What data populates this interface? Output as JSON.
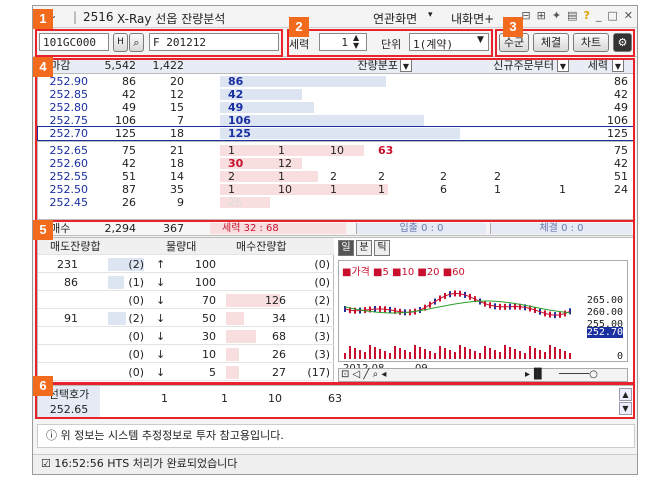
{
  "title": {
    "app": "N~",
    "screen_no": "2516",
    "name": "X-Ray 선옵 잔량분석",
    "menu1": "연관화면",
    "menu2": "내화면+"
  },
  "toolbar": {
    "code": "101GC000",
    "name_field": "F 201212",
    "label_sekyuk": "세력",
    "qty": "1",
    "label_unit": "단위",
    "unit_value": "1(계약)",
    "btn_sugun": "수군",
    "btn_chegyul": "체결",
    "btn_chart": "차트"
  },
  "badges": [
    "1",
    "2",
    "3",
    "4",
    "5",
    "6"
  ],
  "grid": {
    "header": {
      "c1": "장마감",
      "c2": "5,542",
      "c3": "1,422",
      "dist": "잔량분포",
      "new": "신규주문부터",
      "sek": "세력"
    },
    "ask_rows": [
      {
        "price": "252.90",
        "a": "86",
        "b": "20",
        "s1": "86",
        "r": "86",
        "w": 0.69
      },
      {
        "price": "252.85",
        "a": "42",
        "b": "12",
        "s1": "42",
        "r": "42",
        "w": 0.34
      },
      {
        "price": "252.80",
        "a": "49",
        "b": "15",
        "s1": "49",
        "r": "49",
        "w": 0.39
      },
      {
        "price": "252.75",
        "a": "106",
        "b": "7",
        "s1": "106",
        "r": "106",
        "w": 0.85
      },
      {
        "price": "252.70",
        "a": "125",
        "b": "18",
        "s1": "125",
        "r": "125",
        "w": 1.0
      }
    ],
    "bid_rows": [
      {
        "price": "252.65",
        "a": "75",
        "b": "21",
        "v": [
          "1",
          "1",
          "10",
          "63",
          "",
          ""
        ],
        "r": "75",
        "w": 0.6
      },
      {
        "price": "252.60",
        "a": "42",
        "b": "18",
        "v": [
          "30",
          "12",
          "",
          "",
          "",
          ""
        ],
        "r": "42",
        "w": 0.34
      },
      {
        "price": "252.55",
        "a": "51",
        "b": "14",
        "v": [
          "2",
          "1",
          "2",
          "2",
          "2",
          "2"
        ],
        "r": "51",
        "w": 0.41
      },
      {
        "price": "252.50",
        "a": "87",
        "b": "35",
        "v": [
          "1",
          "10",
          "1",
          "1",
          "6",
          "1"
        ],
        "r": "24",
        "w": 0.7
      },
      {
        "price": "252.45",
        "a": "26",
        "b": "9",
        "v": [
          "26",
          "",
          "",
          "",
          "",
          ""
        ],
        "r": "",
        "w": 0.21
      }
    ],
    "bid_row4_extra": "1"
  },
  "summary": {
    "label": "총매수",
    "v1": "2,294",
    "v2": "367",
    "sekyuk": "세력 32 : 68",
    "ipchul": "입출 0 : 0",
    "chegyul": "체결 0 : 0"
  },
  "lower": {
    "headers": {
      "sell": "매도잔량합",
      "band": "물량대",
      "buy": "매수잔량합"
    },
    "rows": [
      {
        "sell": "231",
        "sp": "(2)",
        "dir": "↑",
        "band": "100",
        "buy": "",
        "bp": "(0)",
        "sw": 0.9,
        "bw": 0
      },
      {
        "sell": "86",
        "sp": "(1)",
        "dir": "↓",
        "band": "100",
        "buy": "",
        "bp": "(0)",
        "sw": 0.4,
        "bw": 0
      },
      {
        "sell": "",
        "sp": "(0)",
        "dir": "↓",
        "band": "70",
        "buy": "126",
        "bp": "(2)",
        "sw": 0,
        "bw": 0.9
      },
      {
        "sell": "91",
        "sp": "(2)",
        "dir": "↓",
        "band": "50",
        "buy": "34",
        "bp": "(1)",
        "sw": 0.45,
        "bw": 0.3
      },
      {
        "sell": "",
        "sp": "(0)",
        "dir": "↓",
        "band": "30",
        "buy": "68",
        "bp": "(3)",
        "sw": 0,
        "bw": 0.5
      },
      {
        "sell": "",
        "sp": "(0)",
        "dir": "↓",
        "band": "10",
        "buy": "26",
        "bp": "(3)",
        "sw": 0,
        "bw": 0.22
      },
      {
        "sell": "",
        "sp": "(0)",
        "dir": "↓",
        "band": "5",
        "buy": "27",
        "bp": "(17)",
        "sw": 0,
        "bw": 0.22
      }
    ]
  },
  "chart": {
    "tabs": [
      "일",
      "분",
      "틱"
    ],
    "legend": "■가격 ■5 ■10 ■20 ■60",
    "y_labels": [
      "265.00",
      "260.00",
      "255.00",
      "252.70",
      "0"
    ],
    "x_labels": [
      "2012.08",
      "09"
    ]
  },
  "bottom": {
    "label": "선택호가",
    "price": "252.65",
    "vals": [
      "1",
      "1",
      "10",
      "63"
    ]
  },
  "notice": "ⓘ 위 정보는 시스템 추정정보로 투자 참고용입니다.",
  "status": "☑ 16:52:56  HTS 처리가 완료되었습니다",
  "colors": {
    "red": "#e8232a",
    "orange": "#f26b1d",
    "ask_bar": "#dde4f2",
    "bid_bar": "#f8dede",
    "ask_text": "#1a2fa0",
    "bid_text": "#c8102e"
  }
}
